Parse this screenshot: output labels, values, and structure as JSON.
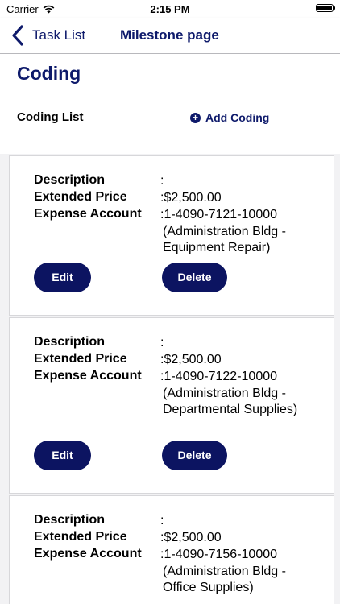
{
  "status_bar": {
    "carrier": "Carrier",
    "time": "2:15 PM"
  },
  "nav": {
    "back_label": "Task List",
    "title": "Milestone page"
  },
  "page": {
    "title": "Coding",
    "list_label": "Coding List",
    "add_label": "Add Coding"
  },
  "labels": {
    "description": "Description",
    "extended_price": "Extended Price",
    "expense_account": "Expense Account"
  },
  "buttons": {
    "edit": "Edit",
    "delete": "Delete"
  },
  "cards": [
    {
      "description": ":",
      "extended_price": ":$2,500.00",
      "expense_account": ":1-4090-7121-10000",
      "account_detail": "(Administration Bldg - Equipment Repair)"
    },
    {
      "description": ":",
      "extended_price": ":$2,500.00",
      "expense_account": ":1-4090-7122-10000",
      "account_detail": "(Administration Bldg - Departmental Supplies)"
    },
    {
      "description": ":",
      "extended_price": ":$2,500.00",
      "expense_account": ":1-4090-7156-10000",
      "account_detail": "(Administration Bldg - Office Supplies)"
    }
  ]
}
